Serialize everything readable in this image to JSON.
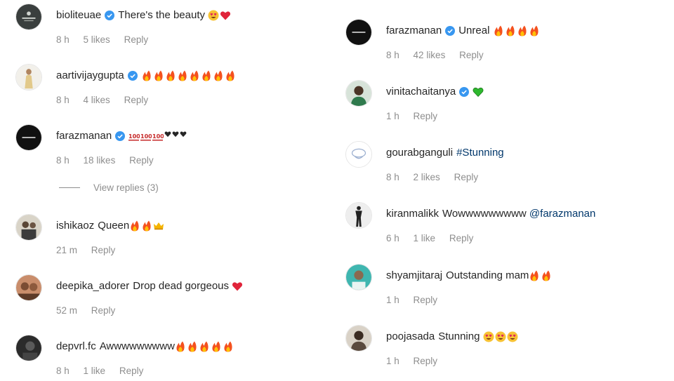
{
  "left_comments": [
    {
      "username": "bioliteuae",
      "verified": true,
      "text": "There's the beauty",
      "emojis": [
        "heart-eyes",
        "red-heart"
      ],
      "time": "8 h",
      "likes": "5 likes",
      "reply": "Reply"
    },
    {
      "username": "aartivijaygupta",
      "verified": true,
      "text": "",
      "emojis": [
        "fire",
        "fire",
        "fire",
        "fire",
        "fire",
        "fire",
        "fire",
        "fire"
      ],
      "time": "8 h",
      "likes": "4 likes",
      "reply": "Reply"
    },
    {
      "username": "farazmanan",
      "verified": true,
      "text": "",
      "emojis": [
        "hundred",
        "hundred",
        "hundred",
        "black-heart",
        "black-heart",
        "black-heart"
      ],
      "time": "8 h",
      "likes": "18 likes",
      "reply": "Reply"
    },
    {
      "username": "ishikaoz",
      "verified": false,
      "text": "Queen",
      "emojis": [
        "fire",
        "fire",
        "crown"
      ],
      "time": "21 m",
      "likes": "",
      "reply": "Reply"
    },
    {
      "username": "deepika_adorer",
      "verified": false,
      "text": "Drop dead gorgeous",
      "emojis": [
        "red-heart"
      ],
      "time": "52 m",
      "likes": "",
      "reply": "Reply"
    },
    {
      "username": "depvrl.fc",
      "verified": false,
      "text": "Awwwwwwwww",
      "emojis": [
        "fire",
        "fire",
        "fire",
        "fire",
        "fire"
      ],
      "time": "8 h",
      "likes": "1 like",
      "reply": "Reply"
    }
  ],
  "view_replies": "View replies (3)",
  "right_comments": [
    {
      "username": "farazmanan",
      "verified": true,
      "text": "Unreal",
      "emojis": [
        "fire",
        "fire",
        "fire",
        "fire"
      ],
      "time": "8 h",
      "likes": "42 likes",
      "reply": "Reply"
    },
    {
      "username": "vinitachaitanya",
      "verified": true,
      "text": "",
      "emojis": [
        "green-heart"
      ],
      "time": "1 h",
      "likes": "",
      "reply": "Reply"
    },
    {
      "username": "gourabganguli",
      "verified": false,
      "text": "",
      "tag": "#Stunning",
      "emojis": [],
      "time": "8 h",
      "likes": "2 likes",
      "reply": "Reply"
    },
    {
      "username": "kiranmalikk",
      "verified": false,
      "text": "Wowwwwwwwww",
      "tag": "@farazmanan",
      "emojis": [],
      "time": "6 h",
      "likes": "1 like",
      "reply": "Reply"
    },
    {
      "username": "shyamjitaraj",
      "verified": false,
      "text": "Outstanding mam",
      "emojis": [
        "fire",
        "fire"
      ],
      "time": "1 h",
      "likes": "",
      "reply": "Reply"
    },
    {
      "username": "poojasada",
      "verified": false,
      "text": "Stunning",
      "emojis": [
        "heart-eyes",
        "heart-eyes",
        "heart-eyes"
      ],
      "time": "1 h",
      "likes": "",
      "reply": "Reply"
    }
  ],
  "colors": {
    "verified": "#3897f0",
    "muted": "#8e8e8e",
    "link": "#00376b",
    "text": "#262626"
  }
}
